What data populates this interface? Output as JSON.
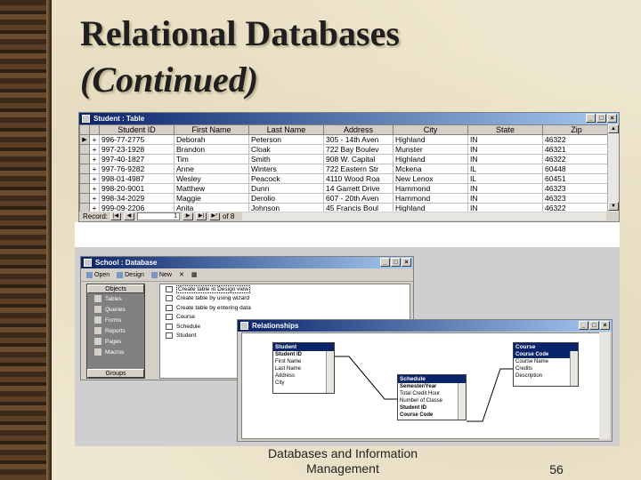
{
  "slide": {
    "title_line1": "Relational Databases",
    "title_line2": "(Continued)",
    "footer_line1": "Databases and Information",
    "footer_line2": "Management",
    "page_number": "56"
  },
  "student_window": {
    "title": "Student : Table",
    "columns": [
      "",
      "",
      "Student ID",
      "First Name",
      "Last Name",
      "Address",
      "City",
      "State",
      "Zip"
    ],
    "rows": [
      [
        "▶",
        "+",
        "996-77-2775",
        "Deborah",
        "Peterson",
        "305 - 14th Aven",
        "Highland",
        "IN",
        "46322"
      ],
      [
        "",
        "+",
        "997-23-1928",
        "Brandon",
        "Cloak",
        "722 Bay Boulev",
        "Munster",
        "IN",
        "46321"
      ],
      [
        "",
        "+",
        "997-40-1827",
        "Tim",
        "Smith",
        "908 W. Capital",
        "Highland",
        "IN",
        "46322"
      ],
      [
        "",
        "+",
        "997-76-9282",
        "Anne",
        "Winters",
        "722 Eastern Str",
        "Mckena",
        "IL",
        "60448"
      ],
      [
        "",
        "+",
        "998-01-4987",
        "Wesley",
        "Peacock",
        "4110 Wood Roa",
        "New Lenox",
        "IL",
        "60451"
      ],
      [
        "",
        "+",
        "998-20-9001",
        "Matthew",
        "Dunn",
        "14 Garrett Drive",
        "Hammond",
        "IN",
        "46323"
      ],
      [
        "",
        "+",
        "998-34-2029",
        "Maggie",
        "Derolio",
        "607 - 20th Aven",
        "Hammond",
        "IN",
        "46323"
      ],
      [
        "",
        "+",
        "999-09-2206",
        "Anita",
        "Johnson",
        "45 Francis Boul",
        "Highland",
        "IN",
        "46322"
      ]
    ],
    "nav": {
      "record_label": "Record:",
      "current": "1",
      "of_text": "of 8"
    }
  },
  "database_window": {
    "title": "School : Database",
    "toolbar": [
      "Open",
      "Design",
      "New"
    ],
    "objects_header": "Objects",
    "groups_header": "Groups",
    "objects": [
      "Tables",
      "Queries",
      "Forms",
      "Reports",
      "Pages",
      "Macros"
    ],
    "items": [
      "Create table in Design view",
      "Create table by using wizard",
      "Create table by entering data",
      "Course",
      "Schedule",
      "Student"
    ]
  },
  "relationships_window": {
    "title": "Relationships",
    "tables": {
      "student": {
        "name": "Student",
        "fields": [
          "Student ID",
          "First Name",
          "Last Name",
          "Address",
          "City"
        ]
      },
      "schedule": {
        "name": "Schedule",
        "fields": [
          "Semester/Year",
          "Total Credit Hour",
          "Number of Classe",
          "Student ID",
          "Course Code"
        ]
      },
      "course": {
        "name": "Course",
        "fields": [
          "Course Code",
          "Course Name",
          "Credits",
          "Description"
        ]
      }
    }
  },
  "colors": {
    "title_bar": "#0a246a",
    "window_face": "#d4d0c8",
    "slide_bg": "#efe7cf"
  }
}
